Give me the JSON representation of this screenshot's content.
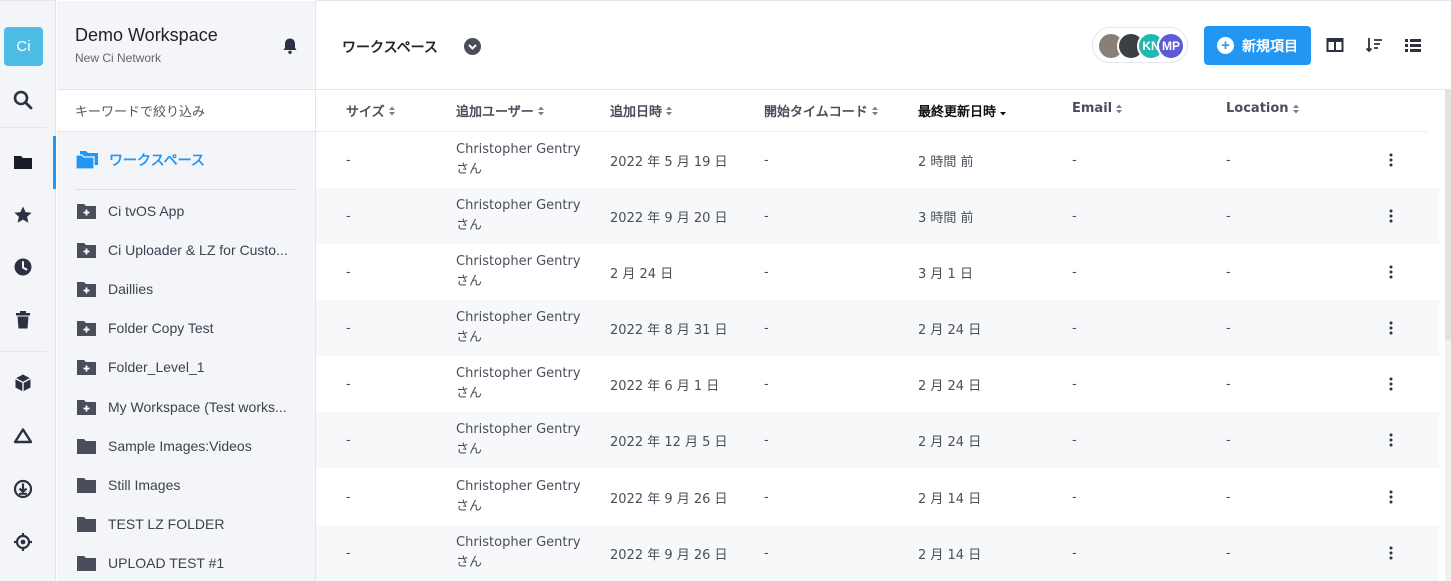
{
  "rail": {
    "logo_text": "Ci",
    "icons": [
      "search-icon",
      "folder-icon",
      "star-icon",
      "clock-icon",
      "trash-icon",
      "cube-icon",
      "triangle-icon",
      "download-icon",
      "target-icon"
    ]
  },
  "sidebar": {
    "workspace_name": "Demo Workspace",
    "network_name": "New Ci Network",
    "filter_placeholder": "キーワードで絞り込み",
    "root_label": "ワークスペース",
    "folders": [
      {
        "label": "Ci tvOS App",
        "icon": "folder-plus-icon"
      },
      {
        "label": "Ci Uploader & LZ for Custo...",
        "icon": "folder-plus-icon"
      },
      {
        "label": "Daillies",
        "icon": "folder-plus-icon"
      },
      {
        "label": "Folder Copy Test",
        "icon": "folder-plus-icon"
      },
      {
        "label": "Folder_Level_1",
        "icon": "folder-plus-icon"
      },
      {
        "label": "My Workspace (Test works...",
        "icon": "folder-plus-icon"
      },
      {
        "label": "Sample Images:Videos",
        "icon": "folder-icon"
      },
      {
        "label": "Still Images",
        "icon": "folder-icon"
      },
      {
        "label": "TEST LZ FOLDER",
        "icon": "folder-icon"
      },
      {
        "label": "UPLOAD TEST #1",
        "icon": "folder-icon"
      }
    ]
  },
  "header": {
    "breadcrumb": "ワークスペース",
    "avatars": [
      {
        "initials": "",
        "color": "#8a7f76"
      },
      {
        "initials": "",
        "color": "#3b3f46"
      },
      {
        "initials": "KN",
        "color": "#22b8b0"
      },
      {
        "initials": "MP",
        "color": "#5b5bd6"
      }
    ],
    "new_button_label": "新規項目",
    "accent_color": "#2196f3"
  },
  "table": {
    "columns": [
      "サイズ",
      "追加ユーザー",
      "追加日時",
      "開始タイムコード",
      "最終更新日時",
      "Email",
      "Location"
    ],
    "sorted_column": "最終更新日時",
    "rows": [
      {
        "size": "-",
        "user": "Christopher Gentry さん",
        "added": "2022 年 5 月 19 日",
        "timecode": "-",
        "updated": "2 時間 前",
        "email": "-",
        "location": "-"
      },
      {
        "size": "-",
        "user": "Christopher Gentry さん",
        "added": "2022 年 9 月 20 日",
        "timecode": "-",
        "updated": "3 時間 前",
        "email": "-",
        "location": "-"
      },
      {
        "size": "-",
        "user": "Christopher Gentry さん",
        "added": "2 月 24 日",
        "timecode": "-",
        "updated": "3 月 1 日",
        "email": "-",
        "location": "-"
      },
      {
        "size": "-",
        "user": "Christopher Gentry さん",
        "added": "2022 年 8 月 31 日",
        "timecode": "-",
        "updated": "2 月 24 日",
        "email": "-",
        "location": "-"
      },
      {
        "size": "-",
        "user": "Christopher Gentry さん",
        "added": "2022 年 6 月 1 日",
        "timecode": "-",
        "updated": "2 月 24 日",
        "email": "-",
        "location": "-"
      },
      {
        "size": "-",
        "user": "Christopher Gentry さん",
        "added": "2022 年 12 月 5 日",
        "timecode": "-",
        "updated": "2 月 24 日",
        "email": "-",
        "location": "-"
      },
      {
        "size": "-",
        "user": "Christopher Gentry さん",
        "added": "2022 年 9 月 26 日",
        "timecode": "-",
        "updated": "2 月 14 日",
        "email": "-",
        "location": "-"
      },
      {
        "size": "-",
        "user": "Christopher Gentry さん",
        "added": "2022 年 9 月 26 日",
        "timecode": "-",
        "updated": "2 月 14 日",
        "email": "-",
        "location": "-"
      }
    ]
  }
}
